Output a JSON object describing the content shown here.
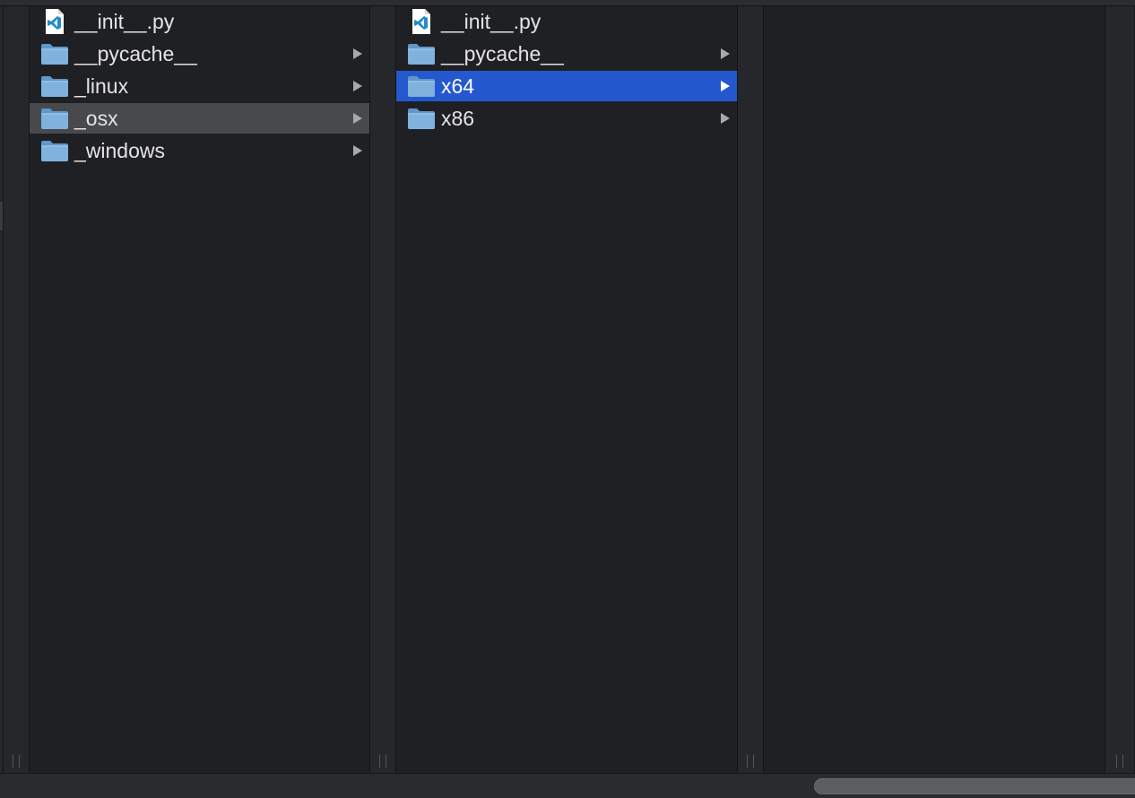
{
  "colors": {
    "folder": "#7fb2dd",
    "selection_active": "#2458ce",
    "selection_inactive": "#48494c",
    "text": "#e4e4e6",
    "vscode_blue": "#2489ca"
  },
  "columns": [
    {
      "items": [
        {
          "label": "__init__.py",
          "icon": "vscode-python-file-icon",
          "kind": "file",
          "has_children": false,
          "state": "none"
        },
        {
          "label": "__pycache__",
          "icon": "folder-icon",
          "kind": "folder",
          "has_children": true,
          "state": "none"
        },
        {
          "label": "_linux",
          "icon": "folder-icon",
          "kind": "folder",
          "has_children": true,
          "state": "none"
        },
        {
          "label": "_osx",
          "icon": "folder-icon",
          "kind": "folder",
          "has_children": true,
          "state": "inactive"
        },
        {
          "label": "_windows",
          "icon": "folder-icon",
          "kind": "folder",
          "has_children": true,
          "state": "none"
        }
      ]
    },
    {
      "items": [
        {
          "label": "__init__.py",
          "icon": "vscode-python-file-icon",
          "kind": "file",
          "has_children": false,
          "state": "none"
        },
        {
          "label": "__pycache__",
          "icon": "folder-icon",
          "kind": "folder",
          "has_children": true,
          "state": "none"
        },
        {
          "label": "x64",
          "icon": "folder-icon",
          "kind": "folder",
          "has_children": true,
          "state": "active"
        },
        {
          "label": "x86",
          "icon": "folder-icon",
          "kind": "folder",
          "has_children": true,
          "state": "none"
        }
      ]
    },
    {
      "items": []
    }
  ]
}
